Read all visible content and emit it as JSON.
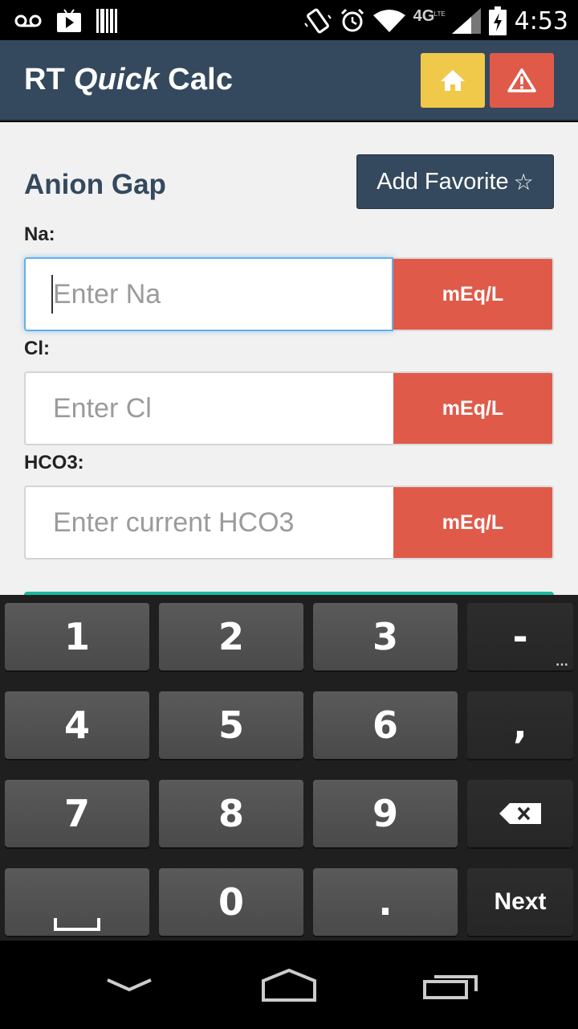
{
  "status_bar": {
    "network": "4G",
    "network_sub": "LTE",
    "time": "4:53"
  },
  "header": {
    "title_prefix": "RT ",
    "title_italic": "Quick",
    "title_suffix": " Calc",
    "home_icon": "home-icon",
    "warning_icon": "warning-icon"
  },
  "calculator": {
    "title": "Anion Gap",
    "favorite_button": "Add Favorite",
    "favorite_icon_glyph": "☆",
    "fields": [
      {
        "label": "Na:",
        "placeholder": "Enter Na",
        "value": "",
        "unit": "mEq/L",
        "focused": true
      },
      {
        "label": "Cl:",
        "placeholder": "Enter Cl",
        "value": "",
        "unit": "mEq/L",
        "focused": false
      },
      {
        "label": "HCO3:",
        "placeholder": "Enter current HCO3",
        "value": "",
        "unit": "mEq/L",
        "focused": false
      }
    ]
  },
  "keyboard": {
    "rows": [
      [
        "1",
        "2",
        "3",
        "-"
      ],
      [
        "4",
        "5",
        "6",
        ","
      ],
      [
        "7",
        "8",
        "9",
        ""
      ],
      [
        "",
        "0",
        ".",
        "Next"
      ]
    ],
    "more_symbols_hint": "..."
  },
  "colors": {
    "header_bg": "#34495e",
    "home_button": "#f0c84a",
    "warning_button": "#e05a4a",
    "unit_button": "#e05a4a",
    "focus_border": "#66afe9",
    "submit_strip": "#1abc9c"
  }
}
